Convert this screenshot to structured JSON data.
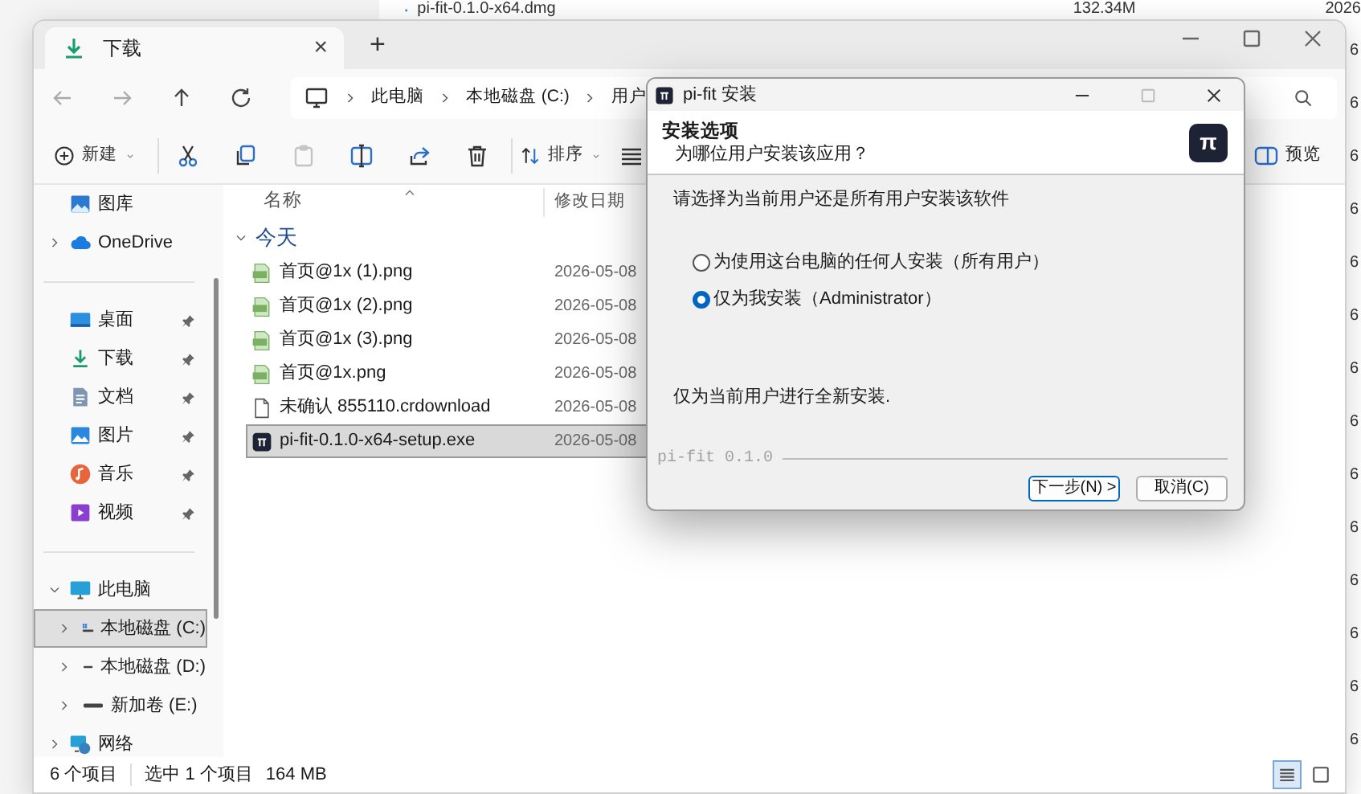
{
  "background_window": {
    "file_name": "pi-fit-0.1.0-x64.dmg",
    "size": "132.34M",
    "date": "2026",
    "cut_column": [
      "6",
      "6",
      "6",
      "6",
      "6",
      "6",
      "6",
      "6",
      "6",
      "6",
      "6",
      "6",
      "6",
      "6"
    ]
  },
  "explorer": {
    "tab": {
      "label": "下载",
      "close": "×"
    },
    "new_tab": "+",
    "breadcrumb": [
      "此电脑",
      "本地磁盘 (C:)",
      "用户"
    ],
    "toolbar": [
      {
        "kind": "new",
        "label": "新建",
        "disabled": false
      },
      {
        "kind": "cut",
        "disabled": false
      },
      {
        "kind": "copy",
        "disabled": false
      },
      {
        "kind": "paste",
        "disabled": true
      },
      {
        "kind": "rename",
        "disabled": false
      },
      {
        "kind": "share",
        "disabled": false
      },
      {
        "kind": "delete",
        "disabled": false
      },
      {
        "kind": "sort",
        "label": "排序",
        "disabled": false
      },
      {
        "kind": "view"
      }
    ],
    "preview_button": {
      "label": "预览"
    },
    "sidebar": {
      "sections": [
        {
          "items": [
            {
              "kind": "gallery",
              "label": "图库",
              "selected": false
            },
            {
              "kind": "cloud",
              "label": "OneDrive",
              "expanded": false,
              "selected": false
            }
          ]
        },
        {
          "items": [
            {
              "kind": "desktop",
              "label": "桌面",
              "pinned": true,
              "selected": false
            },
            {
              "kind": "download",
              "label": "下载",
              "pinned": true,
              "selected": false
            },
            {
              "kind": "documents",
              "label": "文档",
              "pinned": true,
              "selected": false
            },
            {
              "kind": "pictures",
              "label": "图片",
              "pinned": true,
              "selected": false
            },
            {
              "kind": "music",
              "label": "音乐",
              "pinned": true,
              "selected": false
            },
            {
              "kind": "videos",
              "label": "视频",
              "pinned": true,
              "selected": false
            }
          ]
        },
        {
          "items": [
            {
              "kind": "pc",
              "label": "此电脑",
              "expanded": true,
              "selected": false,
              "children": [
                {
                  "kind": "system_drive",
                  "label": "本地磁盘 (C:)",
                  "expanded": false,
                  "selected": true
                },
                {
                  "kind": "drive",
                  "label": "本地磁盘 (D:)",
                  "expanded": false,
                  "selected": false
                },
                {
                  "kind": "drive",
                  "label": "新加卷 (E:)",
                  "expanded": false,
                  "selected": false
                }
              ]
            },
            {
              "kind": "network",
              "label": "网络",
              "expanded": false,
              "selected": false
            }
          ]
        }
      ]
    },
    "columns": [
      {
        "label": "名称",
        "sorted": true
      },
      {
        "label": "修改日期",
        "sorted": false
      }
    ],
    "group": {
      "label": "今天",
      "expanded": true
    },
    "files": [
      {
        "kind": "image",
        "name": "首页@1x (1).png",
        "modified": "2026-05-08",
        "selected": false
      },
      {
        "kind": "image",
        "name": "首页@1x (2).png",
        "modified": "2026-05-08",
        "selected": false
      },
      {
        "kind": "image",
        "name": "首页@1x (3).png",
        "modified": "2026-05-08",
        "selected": false
      },
      {
        "kind": "image",
        "name": "首页@1x.png",
        "modified": "2026-05-08",
        "selected": false
      },
      {
        "kind": "blank",
        "name": "未确认 855110.crdownload",
        "modified": "2026-05-08",
        "selected": false
      },
      {
        "kind": "app",
        "name": "pi-fit-0.1.0-x64-setup.exe",
        "modified": "2026-05-08",
        "selected": true
      }
    ],
    "status_bar": {
      "item_count": "6 个项目",
      "selection": "选中 1 个项目",
      "selection_size": "164 MB"
    },
    "view_buttons": [
      {
        "kind": "details",
        "selected": true
      },
      {
        "kind": "tiles",
        "selected": false
      }
    ]
  },
  "dialog": {
    "title": "pi-fit 安装",
    "heading": "安装选项",
    "subheading": "为哪位用户安装该应用？",
    "logo": "π",
    "prompt": "请选择为当前用户还是所有用户安装该软件",
    "options": [
      {
        "label": "为使用这台电脑的任何人安装（所有用户）",
        "selected": false
      },
      {
        "label": "仅为我安装（Administrator）",
        "selected": true
      }
    ],
    "note": "仅为当前用户进行全新安装.",
    "brand": "pi-fit 0.1.0",
    "buttons": [
      {
        "label": "下一步(N) >",
        "default": true
      },
      {
        "label": "取消(C)",
        "default": false
      }
    ]
  }
}
